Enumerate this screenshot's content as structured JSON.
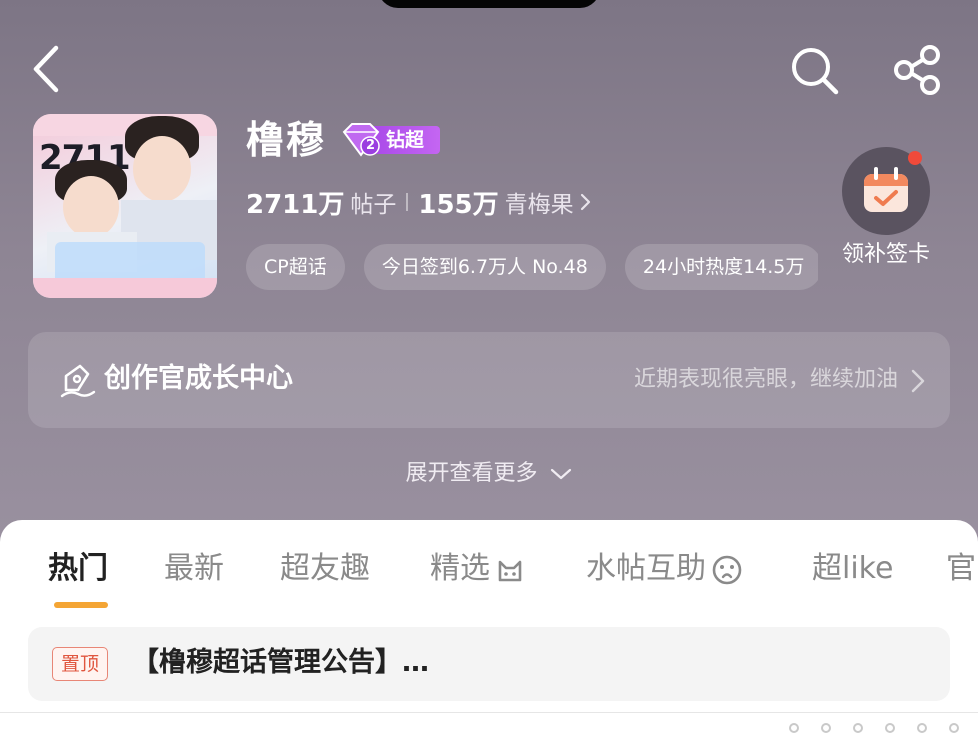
{
  "header": {
    "back_icon": "chevron-left-icon",
    "search_icon": "search-icon",
    "share_icon": "share-icon"
  },
  "profile": {
    "title": "橹穆",
    "badge_level": "2",
    "badge_label": "钻超",
    "cover_number": "2711",
    "posts_count": "2711万",
    "posts_label": "帖子",
    "fans_count": "155万",
    "fans_label": "青梅果",
    "tags": [
      "CP超话",
      "今日签到6.7万人 No.48",
      "24小时热度14.5万"
    ]
  },
  "checkin": {
    "label": "领补签卡",
    "icon": "calendar-check-icon"
  },
  "creator_center": {
    "title": "创作官成长中心",
    "subtitle": "近期表现很亮眼，继续加油"
  },
  "expand": {
    "label": "展开查看更多"
  },
  "tabs": [
    {
      "label": "热门"
    },
    {
      "label": "最新"
    },
    {
      "label": "超友趣"
    },
    {
      "label": "精选"
    },
    {
      "label": "水帖互助"
    },
    {
      "label": "超like"
    },
    {
      "label": "官"
    }
  ],
  "pinned_post": {
    "badge": "置顶",
    "text": "【橹穆超话管理公告】…"
  },
  "colors": {
    "accent": "#f4a534",
    "badge_purple": "#b457ee",
    "notification_dot": "#f04a3a"
  }
}
